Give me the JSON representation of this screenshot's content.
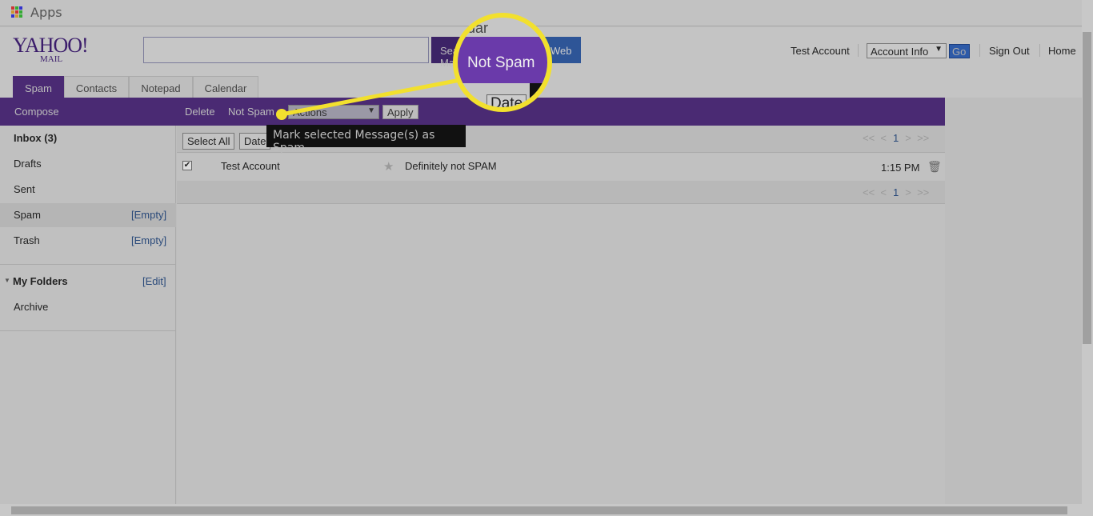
{
  "apps_label": "Apps",
  "logo": {
    "brand": "YAHOO!",
    "sub": "MAIL"
  },
  "search": {
    "value": "",
    "search_label": "Search Mail",
    "web_label": "Web"
  },
  "topnav": {
    "user": "Test Account",
    "account_select": "Account Info",
    "go": "Go",
    "sign_out": "Sign Out",
    "home": "Home"
  },
  "tabs": [
    "Spam",
    "Contacts",
    "Notepad",
    "Calendar"
  ],
  "toolbar": {
    "compose": "Compose",
    "delete": "Delete",
    "not_spam": "Not Spam",
    "actions": "Actions",
    "apply": "Apply"
  },
  "tooltip": "Mark selected Message(s) as Spam",
  "folders": [
    {
      "label": "Inbox (3)"
    },
    {
      "label": "Drafts"
    },
    {
      "label": "Sent"
    },
    {
      "label": "Spam",
      "count": "[Empty]"
    },
    {
      "label": "Trash",
      "count": "[Empty]"
    }
  ],
  "my_folders": {
    "title": "My Folders",
    "edit": "[Edit]",
    "items": [
      "Archive"
    ]
  },
  "list": {
    "select_all": "Select All",
    "sort": "Date",
    "pagination": {
      "first": "<<",
      "prev": "<",
      "page": "1",
      "next": ">",
      "last": ">>"
    }
  },
  "messages": [
    {
      "checked": true,
      "from": "Test Account",
      "subject": "Definitely not SPAM",
      "time": "1:15 PM"
    }
  ],
  "magnifier": {
    "text": "Not Spam",
    "date": "Date",
    "tab_fragment": "dar"
  },
  "colors": {
    "brand_purple": "#4a2a73",
    "highlight": "#f2e02e"
  }
}
